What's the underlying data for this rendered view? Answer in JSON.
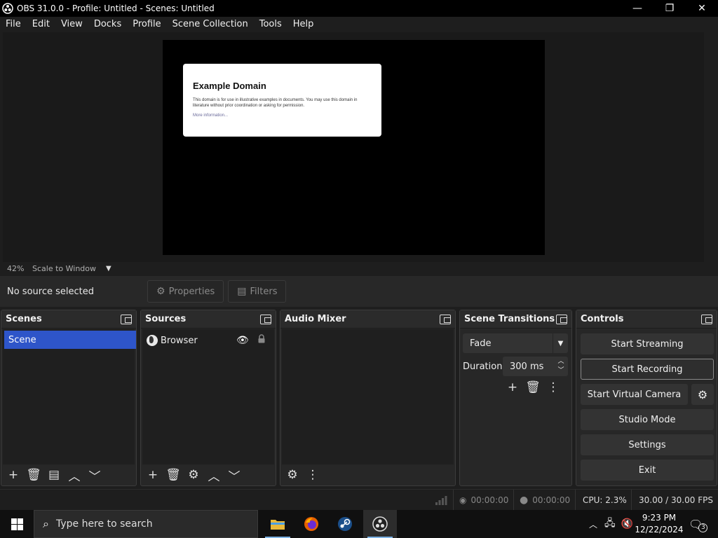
{
  "window": {
    "title": "OBS 31.0.0 - Profile: Untitled - Scenes: Untitled",
    "minimize": "—",
    "maximize": "❐",
    "close": "✕"
  },
  "menu": [
    "File",
    "Edit",
    "View",
    "Docks",
    "Profile",
    "Scene Collection",
    "Tools",
    "Help"
  ],
  "preview": {
    "card_title": "Example Domain",
    "card_text": "This domain is for use in illustrative examples in documents. You may use this domain in literature without prior coordination or asking for permission.",
    "card_link": "More information..."
  },
  "zoom": {
    "level": "42%",
    "mode": "Scale to Window"
  },
  "context": {
    "no_source": "No source selected",
    "properties": "Properties",
    "filters": "Filters"
  },
  "docks": {
    "scenes": {
      "title": "Scenes",
      "items": [
        "Scene"
      ]
    },
    "sources": {
      "title": "Sources",
      "items": [
        "Browser"
      ]
    },
    "audio_mixer": {
      "title": "Audio Mixer"
    },
    "transitions": {
      "title": "Scene Transitions",
      "selected": "Fade",
      "duration_label": "Duration",
      "duration_value": "300 ms"
    },
    "controls": {
      "title": "Controls",
      "start_streaming": "Start Streaming",
      "start_recording": "Start Recording",
      "start_virtual_camera": "Start Virtual Camera",
      "studio_mode": "Studio Mode",
      "settings": "Settings",
      "exit": "Exit"
    }
  },
  "status": {
    "stream_time": "00:00:00",
    "record_time": "00:00:00",
    "cpu": "CPU: 2.3%",
    "fps": "30.00 / 30.00 FPS"
  },
  "taskbar": {
    "search_placeholder": "Type here to search",
    "time": "9:23 PM",
    "date": "12/22/2024",
    "notifications": "3"
  },
  "colors": {
    "accent": "#2e55c9",
    "panel": "#272727",
    "background": "#1e1e1e"
  }
}
